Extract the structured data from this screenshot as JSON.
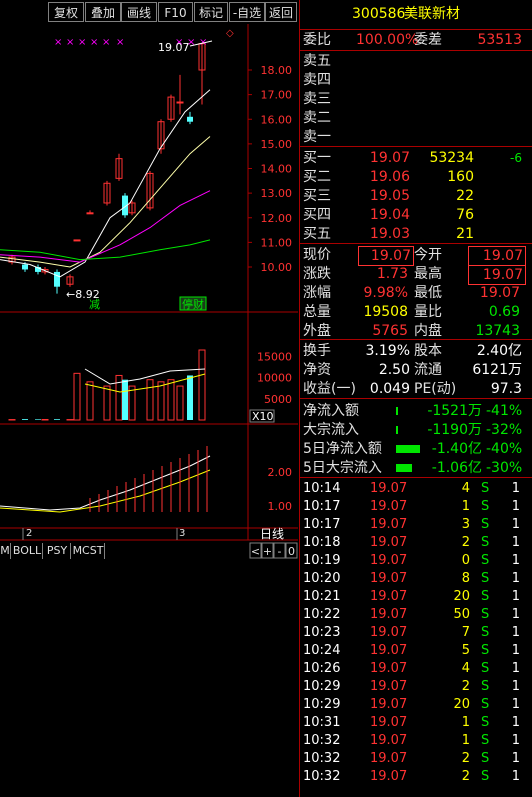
{
  "toolbar": {
    "buttons": [
      "复权",
      "叠加",
      "画线",
      "F10",
      "标记",
      "-自选",
      "返回"
    ]
  },
  "stock": {
    "code": "300586",
    "name": "美联新材"
  },
  "order_book": {
    "weibi_label": "委比",
    "weibi_value": "100.00%",
    "weicha_label": "委差",
    "weicha_value": "53513",
    "sells": [
      {
        "label": "卖五",
        "price": "",
        "vol": ""
      },
      {
        "label": "卖四",
        "price": "",
        "vol": ""
      },
      {
        "label": "卖三",
        "price": "",
        "vol": ""
      },
      {
        "label": "卖二",
        "price": "",
        "vol": ""
      },
      {
        "label": "卖一",
        "price": "",
        "vol": ""
      }
    ],
    "buys": [
      {
        "label": "买一",
        "price": "19.07",
        "vol": "53234",
        "chg": "-6"
      },
      {
        "label": "买二",
        "price": "19.06",
        "vol": "160",
        "chg": ""
      },
      {
        "label": "买三",
        "price": "19.05",
        "vol": "22",
        "chg": ""
      },
      {
        "label": "买四",
        "price": "19.04",
        "vol": "76",
        "chg": ""
      },
      {
        "label": "买五",
        "price": "19.03",
        "vol": "21",
        "chg": ""
      }
    ]
  },
  "quote": {
    "rows": [
      {
        "l1": "现价",
        "v1": "19.07",
        "l2": "今开",
        "v2": "19.07"
      },
      {
        "l1": "涨跌",
        "v1": "1.73",
        "l2": "最高",
        "v2": "19.07"
      },
      {
        "l1": "涨幅",
        "v1": "9.98%",
        "l2": "最低",
        "v2": "19.07"
      },
      {
        "l1": "总量",
        "v1": "19508",
        "l2": "量比",
        "v2": "0.69"
      },
      {
        "l1": "外盘",
        "v1": "5765",
        "l2": "内盘",
        "v2": "13743"
      }
    ],
    "rows2": [
      {
        "l1": "换手",
        "v1": "3.19%",
        "l2": "股本",
        "v2": "2.40亿"
      },
      {
        "l1": "净资",
        "v1": "2.50",
        "l2": "流通",
        "v2": "6121万"
      },
      {
        "l1": "收益(一)",
        "v1": "0.049",
        "l2": "PE(动)",
        "v2": "97.3"
      }
    ]
  },
  "flows": [
    {
      "label": "净流入额",
      "value": "-1521万",
      "pct": "-41%"
    },
    {
      "label": "大宗流入",
      "value": "-1190万",
      "pct": "-32%"
    },
    {
      "label": "5日净流入额",
      "value": "-1.40亿",
      "pct": "-40%"
    },
    {
      "label": "5日大宗流入",
      "value": "-1.06亿",
      "pct": "-30%"
    }
  ],
  "ticks": [
    {
      "time": "10:14",
      "price": "19.07",
      "vol": "4",
      "side": "S",
      "n": "1"
    },
    {
      "time": "10:17",
      "price": "19.07",
      "vol": "1",
      "side": "S",
      "n": "1"
    },
    {
      "time": "10:17",
      "price": "19.07",
      "vol": "3",
      "side": "S",
      "n": "1"
    },
    {
      "time": "10:18",
      "price": "19.07",
      "vol": "2",
      "side": "S",
      "n": "1"
    },
    {
      "time": "10:19",
      "price": "19.07",
      "vol": "0",
      "side": "S",
      "n": "1"
    },
    {
      "time": "10:20",
      "price": "19.07",
      "vol": "8",
      "side": "S",
      "n": "1"
    },
    {
      "time": "10:21",
      "price": "19.07",
      "vol": "20",
      "side": "S",
      "n": "1"
    },
    {
      "time": "10:22",
      "price": "19.07",
      "vol": "50",
      "side": "S",
      "n": "1"
    },
    {
      "time": "10:23",
      "price": "19.07",
      "vol": "7",
      "side": "S",
      "n": "1"
    },
    {
      "time": "10:24",
      "price": "19.07",
      "vol": "5",
      "side": "S",
      "n": "1"
    },
    {
      "time": "10:26",
      "price": "19.07",
      "vol": "4",
      "side": "S",
      "n": "1"
    },
    {
      "time": "10:29",
      "price": "19.07",
      "vol": "2",
      "side": "S",
      "n": "1"
    },
    {
      "time": "10:29",
      "price": "19.07",
      "vol": "20",
      "side": "S",
      "n": "1"
    },
    {
      "time": "10:31",
      "price": "19.07",
      "vol": "1",
      "side": "S",
      "n": "1"
    },
    {
      "time": "10:32",
      "price": "19.07",
      "vol": "1",
      "side": "S",
      "n": "1"
    },
    {
      "time": "10:32",
      "price": "19.07",
      "vol": "2",
      "side": "S",
      "n": "1"
    },
    {
      "time": "10:32",
      "price": "19.07",
      "vol": "2",
      "side": "S",
      "n": "1"
    }
  ],
  "chart": {
    "price_axis": [
      "18.00",
      "17.00",
      "16.00",
      "15.00",
      "14.00",
      "13.00",
      "12.00",
      "11.00",
      "10.00"
    ],
    "high_label": "19.07",
    "low_label": "8.92",
    "vol_axis": [
      "15000",
      "10000",
      "5000"
    ],
    "vol_unit": "X10",
    "ind_axis": [
      "2.00",
      "1.00"
    ],
    "date_marks": [
      "2",
      "3"
    ],
    "period": "日线",
    "tags": [
      "减",
      "停财"
    ],
    "bottom_tabs": [
      "M",
      "BOLL",
      "PSY",
      "MCST"
    ],
    "nav_buttons": [
      "<",
      "+",
      "-",
      "0"
    ],
    "colors": {
      "up": "#ff3232",
      "down": "#54ffff",
      "ma1": "#ffffff",
      "ma2": "#ffff00",
      "ma3": "#ff00ff",
      "ma4": "#00e600",
      "border": "#aa0000"
    }
  },
  "chart_data": {
    "type": "candlestick",
    "candles": [
      {
        "o": 10.2,
        "c": 10.4,
        "h": 10.5,
        "l": 10.1
      },
      {
        "o": 10.1,
        "c": 9.9,
        "h": 10.2,
        "l": 9.8
      },
      {
        "o": 10.0,
        "c": 9.8,
        "h": 10.1,
        "l": 9.7
      },
      {
        "o": 9.8,
        "c": 9.9,
        "h": 10.0,
        "l": 9.7
      },
      {
        "o": 9.8,
        "c": 9.2,
        "h": 9.9,
        "l": 8.92
      },
      {
        "o": 9.3,
        "c": 9.6,
        "h": 9.7,
        "l": 9.2
      },
      {
        "o": 11.1,
        "c": 11.1,
        "h": 11.1,
        "l": 11.1
      },
      {
        "o": 12.2,
        "c": 12.2,
        "h": 12.3,
        "l": 12.2
      },
      {
        "o": 12.6,
        "c": 13.4,
        "h": 13.5,
        "l": 12.5
      },
      {
        "o": 13.6,
        "c": 14.4,
        "h": 14.6,
        "l": 13.5
      },
      {
        "o": 12.9,
        "c": 12.1,
        "h": 13.0,
        "l": 12.0
      },
      {
        "o": 12.2,
        "c": 12.6,
        "h": 12.7,
        "l": 12.1
      },
      {
        "o": 12.4,
        "c": 13.8,
        "h": 13.9,
        "l": 12.3
      },
      {
        "o": 14.8,
        "c": 15.9,
        "h": 16.0,
        "l": 14.6
      },
      {
        "o": 16.0,
        "c": 16.9,
        "h": 17.0,
        "l": 15.9
      },
      {
        "o": 16.7,
        "c": 16.7,
        "h": 17.8,
        "l": 16.2
      },
      {
        "o": 16.1,
        "c": 15.9,
        "h": 16.3,
        "l": 15.8
      },
      {
        "o": 18.0,
        "c": 19.07,
        "h": 19.07,
        "l": 16.6
      }
    ],
    "volumes": [
      100,
      200,
      150,
      120,
      180,
      100,
      11000,
      9000,
      8000,
      10500,
      9500,
      8000,
      9500,
      9000,
      9500,
      8000,
      10500,
      16500
    ]
  }
}
